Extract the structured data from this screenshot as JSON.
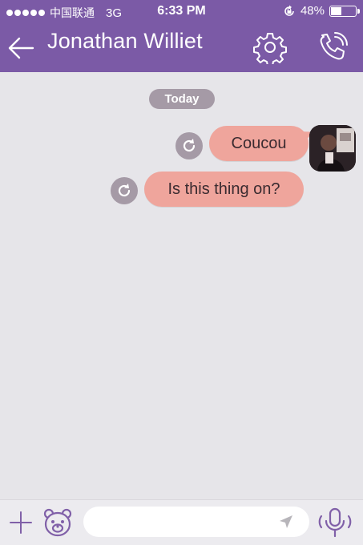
{
  "status_bar": {
    "carrier": "中国联通",
    "network": "3G",
    "time": "6:33 PM",
    "battery_label": "48%",
    "battery_level": 0.48
  },
  "header": {
    "title": "Jonathan Williet",
    "back_icon": "back-arrow-icon",
    "settings_icon": "gear-icon",
    "call_icon": "phone-call-icon",
    "color": "#7b5aa6"
  },
  "chat": {
    "date_label": "Today",
    "messages": [
      {
        "text": "Coucou",
        "status_icon": "retry-icon"
      },
      {
        "text": "Is this thing on?",
        "status_icon": "retry-icon"
      }
    ],
    "bubble_color": "#efa59c"
  },
  "composer": {
    "placeholder": "",
    "add_icon": "plus-icon",
    "sticker_icon": "bear-sticker-icon",
    "send_icon": "send-arrow-icon",
    "mic_icon": "microphone-icon"
  }
}
